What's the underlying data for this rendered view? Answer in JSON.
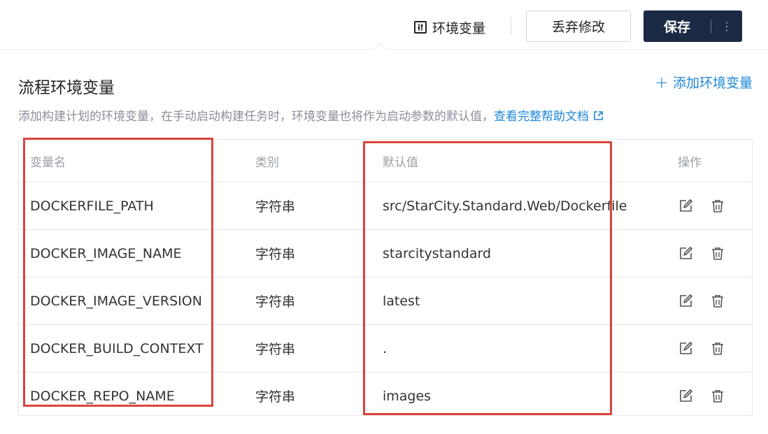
{
  "toolbar": {
    "env_vars_label": "环境变量",
    "discard_label": "丢弃修改",
    "save_label": "保存",
    "more_label": "⋮"
  },
  "section": {
    "title": "流程环境变量",
    "add_label": "添加环境变量",
    "description": "添加构建计划的环境变量，在手动启动构建任务时，环境变量也将作为启动参数的默认值，",
    "help_link": "查看完整帮助文档"
  },
  "table": {
    "headers": {
      "name": "变量名",
      "type": "类别",
      "default": "默认值",
      "ops": "操作"
    },
    "rows": [
      {
        "name": "DOCKERFILE_PATH",
        "type": "字符串",
        "default": "src/StarCity.Standard.Web/Dockerfile"
      },
      {
        "name": "DOCKER_IMAGE_NAME",
        "type": "字符串",
        "default": "starcitystandard"
      },
      {
        "name": "DOCKER_IMAGE_VERSION",
        "type": "字符串",
        "default": "latest"
      },
      {
        "name": "DOCKER_BUILD_CONTEXT",
        "type": "字符串",
        "default": "."
      },
      {
        "name": "DOCKER_REPO_NAME",
        "type": "字符串",
        "default": "images"
      }
    ]
  },
  "colors": {
    "accent": "#1e87d8",
    "primary_button": "#1b2a44",
    "highlight": "#d9453b"
  }
}
